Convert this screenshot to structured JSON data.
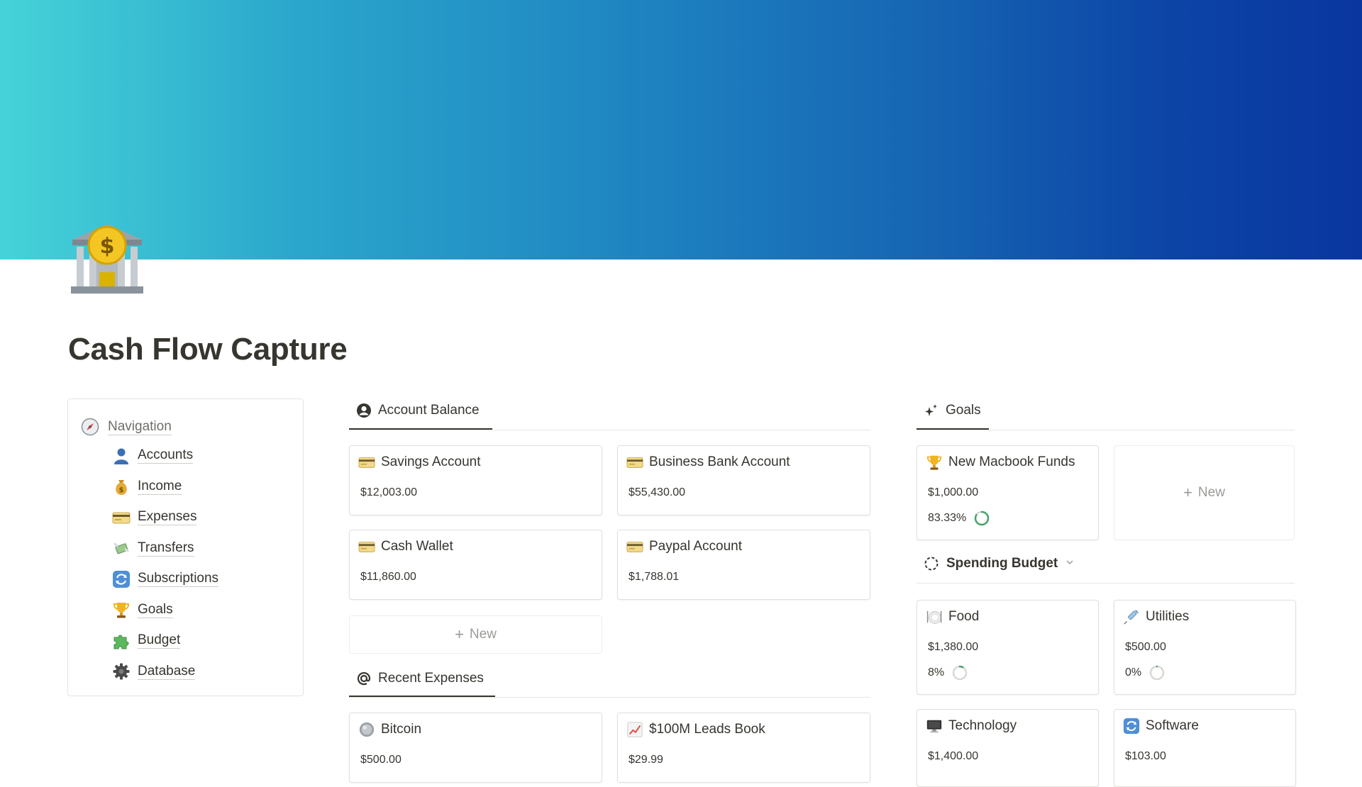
{
  "page": {
    "title": "Cash Flow Capture",
    "icon": "bank-icon"
  },
  "navigation": {
    "heading": "Navigation",
    "heading_icon": "compass-icon",
    "items": [
      {
        "label": "Accounts",
        "icon": "user-silhouette-icon"
      },
      {
        "label": "Income",
        "icon": "money-bag-icon"
      },
      {
        "label": "Expenses",
        "icon": "credit-card-icon"
      },
      {
        "label": "Transfers",
        "icon": "money-with-wings-icon"
      },
      {
        "label": "Subscriptions",
        "icon": "refresh-icon"
      },
      {
        "label": "Goals",
        "icon": "trophy-icon"
      },
      {
        "label": "Budget",
        "icon": "puzzle-icon"
      },
      {
        "label": "Database",
        "icon": "gear-icon"
      }
    ]
  },
  "account_balance": {
    "tab_label": "Account Balance",
    "tab_icon": "user-circle-icon",
    "cards": [
      {
        "name": "Savings Account",
        "amount": "$12,003.00",
        "icon": "credit-card-icon"
      },
      {
        "name": "Business Bank Account",
        "amount": "$55,430.00",
        "icon": "credit-card-icon"
      },
      {
        "name": "Cash Wallet",
        "amount": "$11,860.00",
        "icon": "credit-card-icon"
      },
      {
        "name": "Paypal Account",
        "amount": "$1,788.01",
        "icon": "credit-card-icon"
      }
    ],
    "new_label": "New"
  },
  "recent_expenses": {
    "tab_label": "Recent Expenses",
    "tab_icon": "at-sign-icon",
    "cards": [
      {
        "name": "Bitcoin",
        "amount": "$500.00",
        "icon": "coin-icon"
      },
      {
        "name": "$100M Leads Book",
        "amount": "$29.99",
        "icon": "chart-increasing-icon"
      }
    ]
  },
  "goals": {
    "tab_label": "Goals",
    "tab_icon": "sparkles-icon",
    "cards": [
      {
        "name": "New Macbook Funds",
        "amount": "$1,000.00",
        "percent": "83.33%",
        "progress": 0.8333,
        "icon": "trophy-icon"
      }
    ],
    "new_label": "New"
  },
  "spending_budget": {
    "label": "Spending Budget",
    "icon": "dashed-circle-icon",
    "cards": [
      {
        "name": "Food",
        "amount": "$1,380.00",
        "percent": "8%",
        "progress": 0.08,
        "icon": "plate-icon"
      },
      {
        "name": "Utilities",
        "amount": "$500.00",
        "percent": "0%",
        "progress": 0,
        "icon": "syringe-icon"
      },
      {
        "name": "Technology",
        "amount": "$1,400.00",
        "icon": "desktop-computer-icon"
      },
      {
        "name": "Software",
        "amount": "$103.00",
        "icon": "refresh-icon"
      }
    ]
  },
  "colors": {
    "progress_ring": "#44a36b",
    "ring_track": "#d9d8d4",
    "text": "#37352f",
    "muted": "#9b9a97"
  }
}
